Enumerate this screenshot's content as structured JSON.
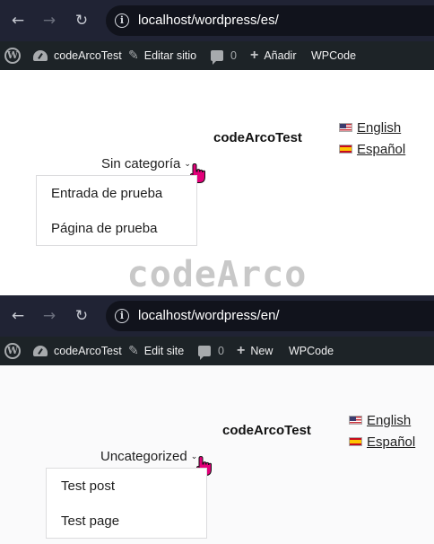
{
  "screens": [
    {
      "url": "localhost/wordpress/es/",
      "admin_bar": {
        "site_name": "codeArcoTest",
        "edit": "Editar sitio",
        "comments": "0",
        "new": "Añadir",
        "plugin": "WPCode"
      },
      "site_title": "codeArcoTest",
      "languages": [
        "English",
        "Español"
      ],
      "category": "Sin categoría",
      "menu_items": [
        "Entrada de prueba",
        "Página de prueba"
      ]
    },
    {
      "url": "localhost/wordpress/en/",
      "admin_bar": {
        "site_name": "codeArcoTest",
        "edit": "Edit site",
        "comments": "0",
        "new": "New",
        "plugin": "WPCode"
      },
      "site_title": "codeArcoTest",
      "languages": [
        "English",
        "Español"
      ],
      "category": "Uncategorized",
      "menu_items": [
        "Test post",
        "Test page"
      ]
    }
  ],
  "watermark": "codeArco",
  "icons": {
    "back": "arrow-left-icon",
    "forward": "arrow-right-icon",
    "reload": "reload-icon",
    "site_info": "info-icon",
    "wordpress": "wordpress-logo-icon",
    "dashboard": "gauge-icon",
    "edit": "brush-icon",
    "comments": "comment-bubble-icon",
    "new": "plus-icon",
    "cursor": "hand-pointer-cursor-icon"
  },
  "colors": {
    "browser_bar": "#202334",
    "admin_bar": "#1d2327",
    "cursor": "#e3007a"
  }
}
